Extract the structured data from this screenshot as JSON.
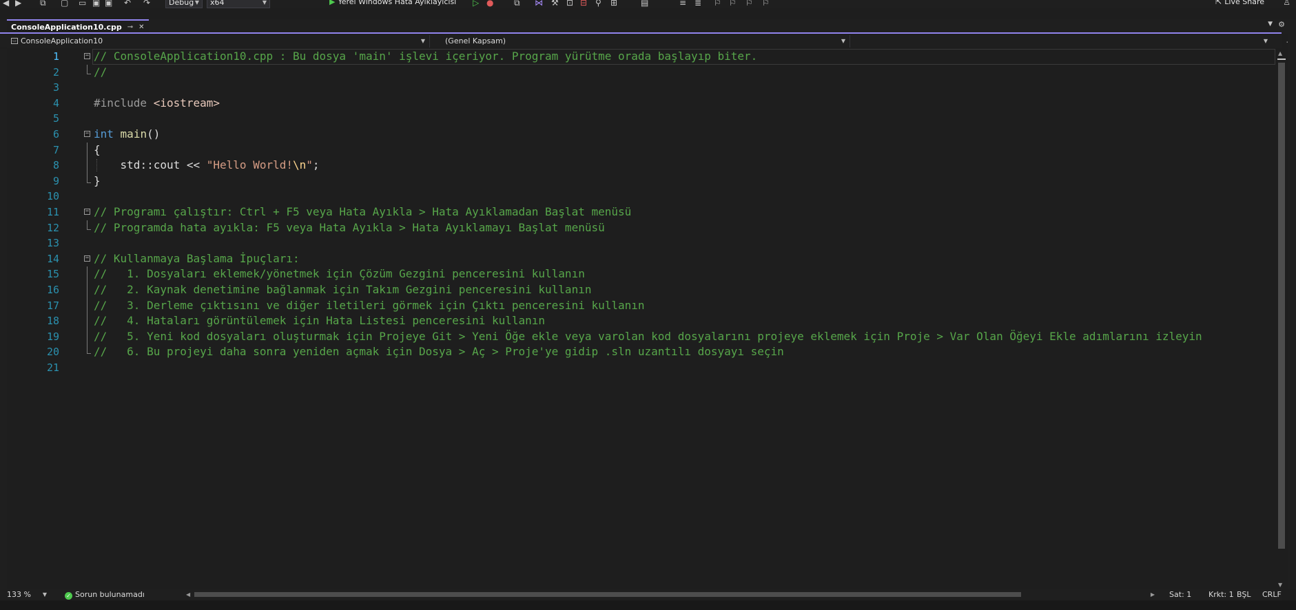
{
  "toolbar": {
    "configuration": "Debug",
    "platform": "x64",
    "run_label": "Yerel Windows Hata Ayıklayıcısı",
    "live_share": "Live Share"
  },
  "tab": {
    "title": "ConsoleApplication10.cpp",
    "pin_icon": "⊸",
    "close_icon": "✕"
  },
  "navbar": {
    "project": "ConsoleApplication10",
    "scope": "(Genel Kapsam)",
    "member": ""
  },
  "editor": {
    "lines": [
      {
        "num": "1",
        "tokens": [
          {
            "t": "// ConsoleApplication10.cpp : Bu dosya 'main' işlevi içeriyor. Program yürütme orada başlayıp biter.",
            "c": "comment"
          }
        ]
      },
      {
        "num": "2",
        "tokens": [
          {
            "t": "//",
            "c": "comment"
          }
        ]
      },
      {
        "num": "3",
        "tokens": []
      },
      {
        "num": "4",
        "tokens": [
          {
            "t": "#include ",
            "c": "pp"
          },
          {
            "t": "<iostream>",
            "c": "include"
          }
        ]
      },
      {
        "num": "5",
        "tokens": []
      },
      {
        "num": "6",
        "tokens": [
          {
            "t": "int",
            "c": "kw"
          },
          {
            "t": " ",
            "c": "plain"
          },
          {
            "t": "main",
            "c": "fn"
          },
          {
            "t": "()",
            "c": "plain"
          }
        ]
      },
      {
        "num": "7",
        "tokens": [
          {
            "t": "{",
            "c": "plain"
          }
        ]
      },
      {
        "num": "8",
        "tokens": [
          {
            "t": "    std",
            "c": "ns"
          },
          {
            "t": "::",
            "c": "plain"
          },
          {
            "t": "cout",
            "c": "plain"
          },
          {
            "t": " << ",
            "c": "plain"
          },
          {
            "t": "\"Hello World!",
            "c": "str"
          },
          {
            "t": "\\n",
            "c": "esc"
          },
          {
            "t": "\"",
            "c": "str"
          },
          {
            "t": ";",
            "c": "plain"
          }
        ]
      },
      {
        "num": "9",
        "tokens": [
          {
            "t": "}",
            "c": "plain"
          }
        ]
      },
      {
        "num": "10",
        "tokens": []
      },
      {
        "num": "11",
        "tokens": [
          {
            "t": "// Programı çalıştır: Ctrl + F5 veya Hata Ayıkla > Hata Ayıklamadan Başlat menüsü",
            "c": "comment"
          }
        ]
      },
      {
        "num": "12",
        "tokens": [
          {
            "t": "// Programda hata ayıkla: F5 veya Hata Ayıkla > Hata Ayıklamayı Başlat menüsü",
            "c": "comment"
          }
        ]
      },
      {
        "num": "13",
        "tokens": []
      },
      {
        "num": "14",
        "tokens": [
          {
            "t": "// Kullanmaya Başlama İpuçları:",
            "c": "comment"
          }
        ]
      },
      {
        "num": "15",
        "tokens": [
          {
            "t": "//   1. Dosyaları eklemek/yönetmek için Çözüm Gezgini penceresini kullanın",
            "c": "comment"
          }
        ]
      },
      {
        "num": "16",
        "tokens": [
          {
            "t": "//   2. Kaynak denetimine bağlanmak için Takım Gezgini penceresini kullanın",
            "c": "comment"
          }
        ]
      },
      {
        "num": "17",
        "tokens": [
          {
            "t": "//   3. Derleme çıktısını ve diğer iletileri görmek için Çıktı penceresini kullanın",
            "c": "comment"
          }
        ]
      },
      {
        "num": "18",
        "tokens": [
          {
            "t": "//   4. Hataları görüntülemek için Hata Listesi penceresini kullanın",
            "c": "comment"
          }
        ]
      },
      {
        "num": "19",
        "tokens": [
          {
            "t": "//   5. Yeni kod dosyaları oluşturmak için Projeye Git > Yeni Öğe ekle veya varolan kod dosyalarını projeye eklemek için Proje > Var Olan Öğeyi Ekle adımlarını izleyin",
            "c": "comment"
          }
        ]
      },
      {
        "num": "20",
        "tokens": [
          {
            "t": "//   6. Bu projeyi daha sonra yeniden açmak için Dosya > Aç > Proje'ye gidip .sln uzantılı dosyayı seçin",
            "c": "comment"
          }
        ]
      },
      {
        "num": "21",
        "tokens": []
      }
    ]
  },
  "status": {
    "zoom": "133 %",
    "issues": "Sorun bulunamadı",
    "line": "Sat: 1",
    "column": "Krkt: 1",
    "indent": "BŞL",
    "line_ending": "CRLF"
  },
  "colors": {
    "background": "#1e1e1e",
    "comment": "#57a64a",
    "keyword": "#569cd6",
    "string": "#d69d85",
    "line_number": "#2b91af",
    "accent": "#9184ee"
  }
}
